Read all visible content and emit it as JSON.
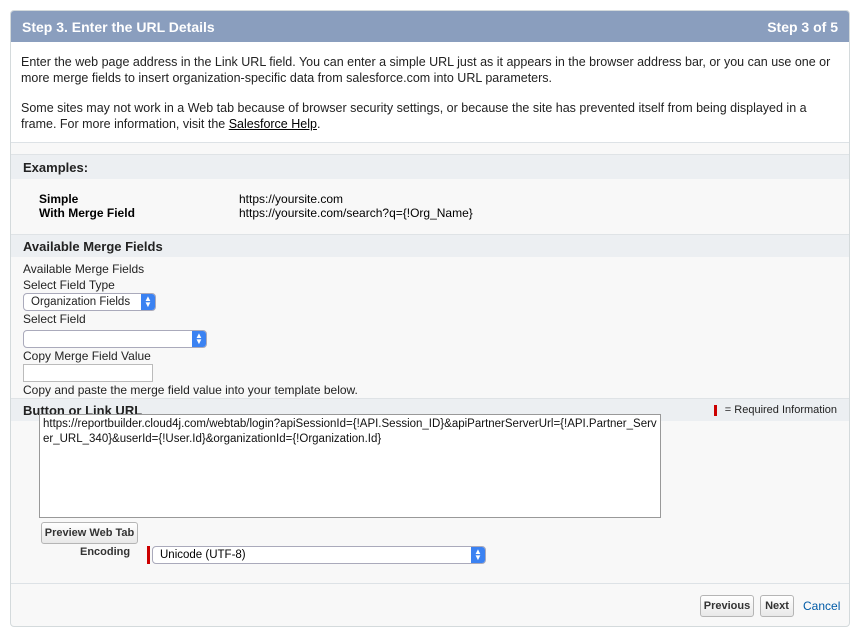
{
  "header": {
    "title": "Step 3. Enter the URL Details",
    "step": "Step 3 of 5"
  },
  "intro": {
    "paragraph1": "Enter the web page address in the Link URL field. You can enter a simple URL just as it appears in the browser address bar, or you can use one or more merge fields to insert organization-specific data from salesforce.com into URL parameters.",
    "paragraph2_prefix": "Some sites may not work in a Web tab because of browser security settings, or because the site has prevented itself from being displayed in a frame. For more information, visit the ",
    "help_link": "Salesforce Help",
    "paragraph2_suffix": "."
  },
  "examples": {
    "heading": "Examples:",
    "rows": [
      {
        "label": "Simple",
        "value": "https://yoursite.com"
      },
      {
        "label": "With Merge Field",
        "value": "https://yoursite.com/search?q={!Org_Name}"
      }
    ]
  },
  "merge_fields": {
    "heading": "Available Merge Fields",
    "subheading": "Available Merge Fields",
    "field_type_label": "Select Field Type",
    "field_type_value": "Organization Fields",
    "field_label": "Select Field",
    "field_value": "",
    "copy_label": "Copy Merge Field Value",
    "copy_value": "",
    "hint": "Copy and paste the merge field value into your template below."
  },
  "url_section": {
    "heading": "Button or Link URL",
    "required_text": "= Required Information",
    "url_value": "https://reportbuilder.cloud4j.com/webtab/login?apiSessionId={!API.Session_ID}&apiPartnerServerUrl={!API.Partner_Server_URL_340}&userId={!User.Id}&organizationId={!Organization.Id}",
    "preview_button": "Preview Web Tab",
    "encoding_label": "Encoding",
    "encoding_value": "Unicode (UTF-8)"
  },
  "footer": {
    "previous": "Previous",
    "next": "Next",
    "cancel": "Cancel"
  },
  "colors": {
    "header_bg": "#8a9ebe",
    "required": "#cc0000",
    "select_arrow": "#3b82f2",
    "link": "#015ba7"
  }
}
